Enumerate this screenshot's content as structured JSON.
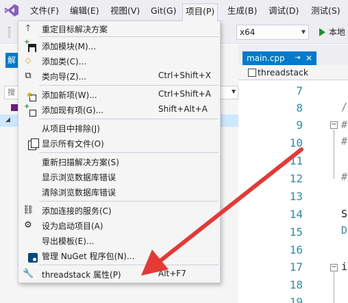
{
  "menubar": {
    "items": [
      {
        "label": "文件(F)"
      },
      {
        "label": "编辑(E)"
      },
      {
        "label": "视图(V)"
      },
      {
        "label": "Git(G)"
      },
      {
        "label": "项目(P)"
      },
      {
        "label": "生成(B)"
      },
      {
        "label": "调试(D)"
      },
      {
        "label": "测试(S)"
      }
    ]
  },
  "toolbar": {
    "platform": "x64",
    "run_label": "本地"
  },
  "side_panel": {
    "tab_label": "解",
    "search_label": "搜"
  },
  "editor": {
    "tab": {
      "label": "main.cpp",
      "pin_glyph": "⇥",
      "close_glyph": "✕"
    },
    "nav_label": "threadstack",
    "line_numbers": [
      "7",
      "8",
      "9",
      "10",
      "11",
      "12",
      "13",
      "14",
      "15",
      "16",
      "17",
      "18",
      "19"
    ],
    "fragments": [
      "/",
      "#",
      "#",
      "#",
      "S",
      "D",
      "i"
    ]
  },
  "project_menu": {
    "items": [
      {
        "icon": "arrow-up-icon",
        "label": "重定目标解决方案",
        "shortcut": ""
      },
      {
        "icon": "add-module-icon",
        "label": "添加模块(M)...",
        "shortcut": ""
      },
      {
        "icon": "add-class-icon",
        "label": "添加类(C)...",
        "shortcut": ""
      },
      {
        "icon": "class-wizard-icon",
        "label": "类向导(Z)...",
        "shortcut": "Ctrl+Shift+X"
      },
      {
        "icon": "add-new-item-icon",
        "label": "添加新项(W)...",
        "shortcut": "Ctrl+Shift+A"
      },
      {
        "icon": "add-existing-item-icon",
        "label": "添加现有项(G)...",
        "shortcut": "Shift+Alt+A"
      },
      {
        "icon": "",
        "label": "从项目中排除(J)",
        "shortcut": ""
      },
      {
        "icon": "show-all-files-icon",
        "label": "显示所有文件(O)",
        "shortcut": ""
      },
      {
        "icon": "",
        "label": "重新扫描解决方案(S)",
        "shortcut": ""
      },
      {
        "icon": "",
        "label": "显示浏览数据库错误",
        "shortcut": ""
      },
      {
        "icon": "",
        "label": "清除浏览数据库错误",
        "shortcut": ""
      },
      {
        "icon": "add-connected-service-icon",
        "label": "添加连接的服务(C)",
        "shortcut": ""
      },
      {
        "icon": "gear-icon",
        "label": "设为启动项目(A)",
        "shortcut": ""
      },
      {
        "icon": "",
        "label": "导出模板(E)...",
        "shortcut": ""
      },
      {
        "icon": "nuget-icon",
        "label": "管理 NuGet 程序包(N)...",
        "shortcut": ""
      },
      {
        "icon": "wrench-icon",
        "label": "threadstack 属性(P)",
        "shortcut": "Alt+F7"
      }
    ]
  },
  "colors": {
    "accent": "#007acc",
    "annotation_arrow": "#e53935"
  }
}
